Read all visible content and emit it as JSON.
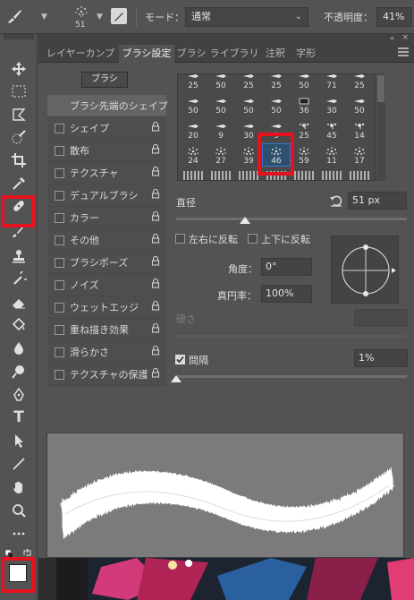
{
  "options_bar": {
    "brush_size": "51",
    "mode_label": "モード：",
    "mode_value": "通常",
    "opacity_label": "不透明度：",
    "opacity_value": "41%"
  },
  "tabs": [
    {
      "label": "レイヤーカンプ",
      "active": false
    },
    {
      "label": "ブラシ設定",
      "active": true
    },
    {
      "label": "ブラシ",
      "active": false
    },
    {
      "label": "ライブラリ",
      "active": false
    },
    {
      "label": "注釈",
      "active": false
    },
    {
      "label": "字形",
      "active": false
    }
  ],
  "brush_button_label": "ブラシ",
  "settings_list": [
    {
      "label": "ブラシ先端のシェイプ",
      "checkbox": false,
      "lock": false,
      "selected": true
    },
    {
      "label": "シェイプ",
      "checkbox": true,
      "lock": true
    },
    {
      "label": "散布",
      "checkbox": true,
      "lock": true
    },
    {
      "label": "テクスチャ",
      "checkbox": true,
      "lock": true
    },
    {
      "label": "デュアルブラシ",
      "checkbox": true,
      "lock": true
    },
    {
      "label": "カラー",
      "checkbox": true,
      "lock": true
    },
    {
      "label": "その他",
      "checkbox": true,
      "lock": true
    },
    {
      "label": "ブラシポーズ",
      "checkbox": true,
      "lock": true
    },
    {
      "label": "ノイズ",
      "checkbox": true,
      "lock": true
    },
    {
      "label": "ウェットエッジ",
      "checkbox": true,
      "lock": true
    },
    {
      "label": "重ね描き効果",
      "checkbox": true,
      "lock": true
    },
    {
      "label": "滑らかさ",
      "checkbox": true,
      "lock": true
    },
    {
      "label": "テクスチャの保護",
      "checkbox": true,
      "lock": true
    }
  ],
  "brush_grid": [
    [
      "25",
      "50",
      "25",
      "25",
      "50",
      "71",
      "25"
    ],
    [
      "50",
      "50",
      "50",
      "50",
      "36",
      "30",
      "50"
    ],
    [
      "20",
      "9",
      "30",
      "9",
      "25",
      "45",
      "14"
    ],
    [
      "24",
      "27",
      "39",
      "46",
      "59",
      "11",
      "17"
    ]
  ],
  "selected_brush": "46",
  "diameter_label": "直径",
  "diameter_value": "51 px",
  "flip_x_label": "左右に反転",
  "flip_y_label": "上下に反転",
  "angle_label": "角度：",
  "angle_value": "0°",
  "roundness_label": "真円率：",
  "roundness_value": "100%",
  "hardness_label": "硬さ",
  "spacing_label": "間隔",
  "spacing_value": "1%",
  "spacing_checked": true,
  "diameter_slider_fraction": 0.3,
  "spacing_slider_fraction": 0.0
}
